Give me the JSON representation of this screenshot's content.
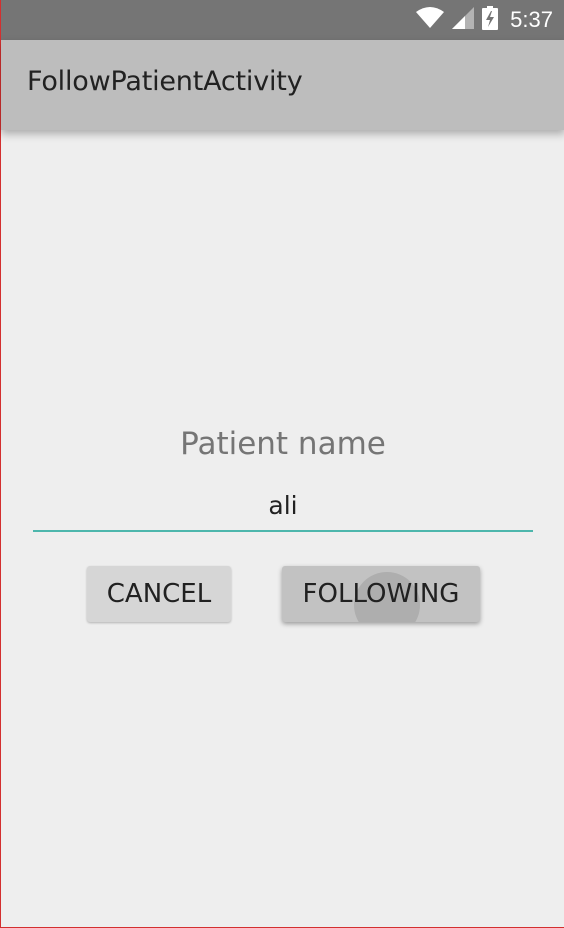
{
  "status_bar": {
    "time": "5:37",
    "icons": [
      "wifi-icon",
      "signal-icon",
      "battery-charging-icon"
    ]
  },
  "app_bar": {
    "title": "FollowPatientActivity"
  },
  "form": {
    "label": "Patient name",
    "input_value": "ali"
  },
  "buttons": {
    "cancel_label": "CANCEL",
    "following_label": "FOLLOWING"
  },
  "colors": {
    "status_bar": "#757575",
    "app_bar": "#bdbdbd",
    "background": "#eeeeee",
    "input_underline": "#4db6ac"
  }
}
